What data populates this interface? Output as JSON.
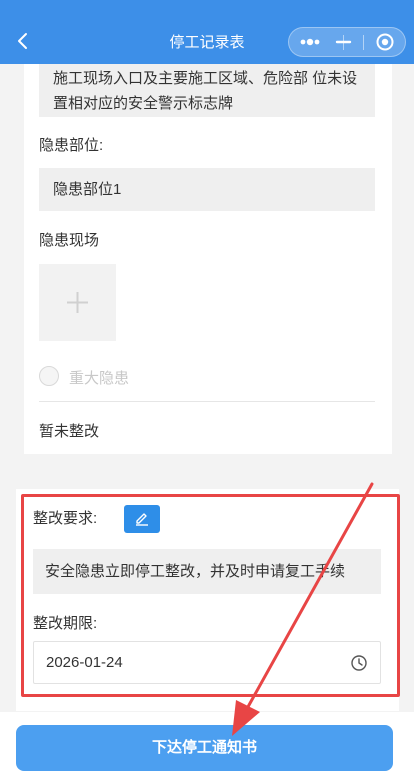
{
  "header": {
    "title": "停工记录表"
  },
  "hazard": {
    "description": "施工现场入口及主要施工区域、危险部 位未设置相对应的安全警示标志牌",
    "location_label": "隐患部位:",
    "location_value": "隐患部位1",
    "scene_label": "隐患现场",
    "major_label": "重大隐患",
    "status": "暂未整改"
  },
  "rectification": {
    "requirement_label": "整改要求:",
    "requirement_value": "安全隐患立即停工整改，并及时申请复工手续",
    "deadline_label": "整改期限:",
    "deadline_value": "2026-01-24"
  },
  "footer": {
    "issue_button": "下达停工通知书"
  },
  "colors": {
    "header_bg": "#3d8fe8",
    "primary_button": "#4c9ff0",
    "edit_button": "#2e8ee8",
    "annotation_red": "#e84545"
  },
  "icons": {
    "back": "back-arrow-icon",
    "more": "more-dots-icon",
    "minimize": "minimize-icon",
    "close": "target-close-icon",
    "add": "plus-icon",
    "edit": "pencil-icon",
    "time": "clock-icon"
  }
}
